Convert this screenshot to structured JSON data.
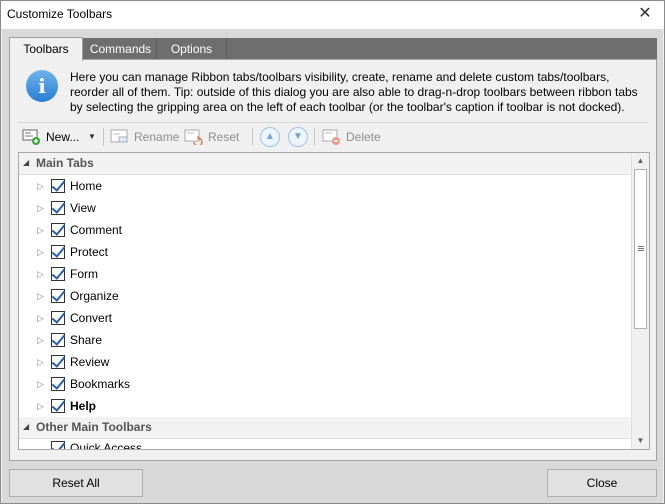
{
  "window": {
    "title": "Customize Toolbars",
    "close_glyph": "✕"
  },
  "tabs": [
    {
      "label": "Toolbars",
      "active": true
    },
    {
      "label": "Commands",
      "active": false
    },
    {
      "label": "Options",
      "active": false
    }
  ],
  "info": {
    "icon": "info-icon",
    "text": "Here you can manage Ribbon tabs/toolbars visibility, create, rename and delete custom tabs/toolbars, reorder all of them. Tip: outside of this dialog you are also able to drag-n-drop toolbars between ribbon tabs by selecting the gripping area on the left of each toolbar (or the toolbar's caption if toolbar is not docked)."
  },
  "toolbar": {
    "new_label": "New...",
    "rename_label": "Rename",
    "reset_label": "Reset",
    "delete_label": "Delete"
  },
  "tree": {
    "main_tabs_label": "Main Tabs",
    "items": [
      {
        "label": "Home",
        "checked": true,
        "bold": false
      },
      {
        "label": "View",
        "checked": true,
        "bold": false
      },
      {
        "label": "Comment",
        "checked": true,
        "bold": false
      },
      {
        "label": "Protect",
        "checked": true,
        "bold": false
      },
      {
        "label": "Form",
        "checked": true,
        "bold": false
      },
      {
        "label": "Organize",
        "checked": true,
        "bold": false
      },
      {
        "label": "Convert",
        "checked": true,
        "bold": false
      },
      {
        "label": "Share",
        "checked": true,
        "bold": false
      },
      {
        "label": "Review",
        "checked": true,
        "bold": false
      },
      {
        "label": "Bookmarks",
        "checked": true,
        "bold": false
      },
      {
        "label": "Help",
        "checked": true,
        "bold": true
      }
    ],
    "other_toolbars_label": "Other Main Toolbars",
    "partial_item_label": "Quick Access"
  },
  "footer": {
    "reset_all_label": "Reset All",
    "close_label": "Close"
  },
  "colors": {
    "tabstrip": "#6e6e6e",
    "accent": "#2a5fa8"
  }
}
